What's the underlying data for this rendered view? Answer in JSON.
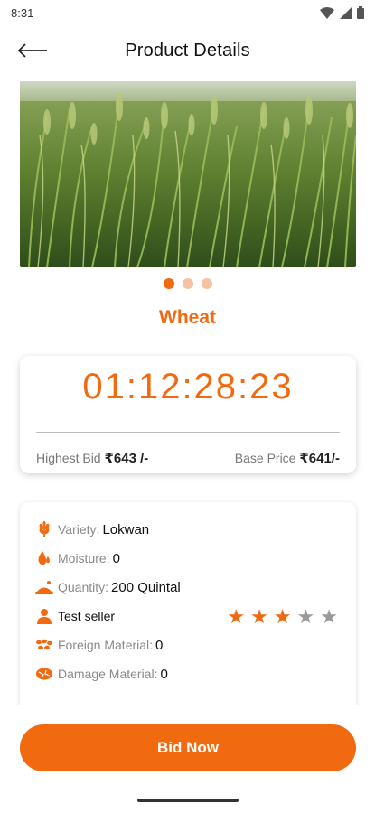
{
  "status_bar": {
    "time": "8:31"
  },
  "app_bar": {
    "title": "Product Details",
    "back_icon": "arrow-left-icon"
  },
  "hero": {
    "description": "wheat field image",
    "slides_total": 3,
    "slide_active": 1
  },
  "product": {
    "name": "Wheat"
  },
  "auction": {
    "countdown": "01:12:28:23",
    "highest_bid_label": "Highest Bid",
    "highest_bid_value": "₹643 /-",
    "base_price_label": "Base Price",
    "base_price_value": "₹641/-"
  },
  "details": {
    "variety_label": "Variety:",
    "variety_value": "Lokwan",
    "moisture_label": "Moisture:",
    "moisture_value": "0",
    "quantity_label": "Quantity:",
    "quantity_value": "200 Quintal",
    "seller_name": "Test seller",
    "seller_rating": 3,
    "seller_rating_max": 5,
    "foreign_label": "Foreign Material:",
    "foreign_value": "0",
    "damage_label": "Damage Material:",
    "damage_value": "0"
  },
  "actions": {
    "bid_now": "Bid Now"
  },
  "colors": {
    "accent": "#f26a10",
    "accent_light": "#f6c3a2",
    "star_empty": "#9a9a9a"
  }
}
